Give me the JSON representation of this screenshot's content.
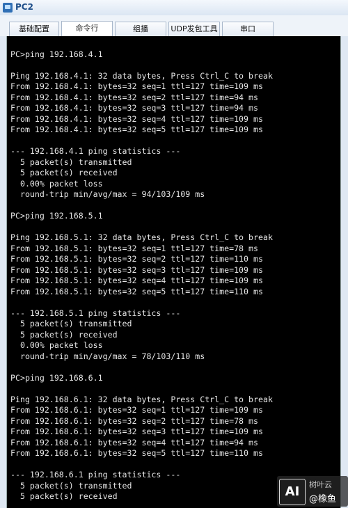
{
  "window": {
    "title": "PC2"
  },
  "tabs": [
    "基础配置",
    "命令行",
    "组播",
    "UDP发包工具",
    "串口"
  ],
  "terminal_lines": [
    "",
    "PC>ping 192.168.4.1",
    "",
    "Ping 192.168.4.1: 32 data bytes, Press Ctrl_C to break",
    "From 192.168.4.1: bytes=32 seq=1 ttl=127 time=109 ms",
    "From 192.168.4.1: bytes=32 seq=2 ttl=127 time=94 ms",
    "From 192.168.4.1: bytes=32 seq=3 ttl=127 time=94 ms",
    "From 192.168.4.1: bytes=32 seq=4 ttl=127 time=109 ms",
    "From 192.168.4.1: bytes=32 seq=5 ttl=127 time=109 ms",
    "",
    "--- 192.168.4.1 ping statistics ---",
    "  5 packet(s) transmitted",
    "  5 packet(s) received",
    "  0.00% packet loss",
    "  round-trip min/avg/max = 94/103/109 ms",
    "",
    "PC>ping 192.168.5.1",
    "",
    "Ping 192.168.5.1: 32 data bytes, Press Ctrl_C to break",
    "From 192.168.5.1: bytes=32 seq=1 ttl=127 time=78 ms",
    "From 192.168.5.1: bytes=32 seq=2 ttl=127 time=110 ms",
    "From 192.168.5.1: bytes=32 seq=3 ttl=127 time=109 ms",
    "From 192.168.5.1: bytes=32 seq=4 ttl=127 time=109 ms",
    "From 192.168.5.1: bytes=32 seq=5 ttl=127 time=110 ms",
    "",
    "--- 192.168.5.1 ping statistics ---",
    "  5 packet(s) transmitted",
    "  5 packet(s) received",
    "  0.00% packet loss",
    "  round-trip min/avg/max = 78/103/110 ms",
    "",
    "PC>ping 192.168.6.1",
    "",
    "Ping 192.168.6.1: 32 data bytes, Press Ctrl_C to break",
    "From 192.168.6.1: bytes=32 seq=1 ttl=127 time=109 ms",
    "From 192.168.6.1: bytes=32 seq=2 ttl=127 time=78 ms",
    "From 192.168.6.1: bytes=32 seq=3 ttl=127 time=109 ms",
    "From 192.168.6.1: bytes=32 seq=4 ttl=127 time=94 ms",
    "From 192.168.6.1: bytes=32 seq=5 ttl=127 time=110 ms",
    "",
    "--- 192.168.6.1 ping statistics ---",
    "  5 packet(s) transmitted",
    "  5 packet(s) received"
  ],
  "watermark": {
    "logo": "AI",
    "line1": "树叶云",
    "line2": "@橡鱼"
  }
}
